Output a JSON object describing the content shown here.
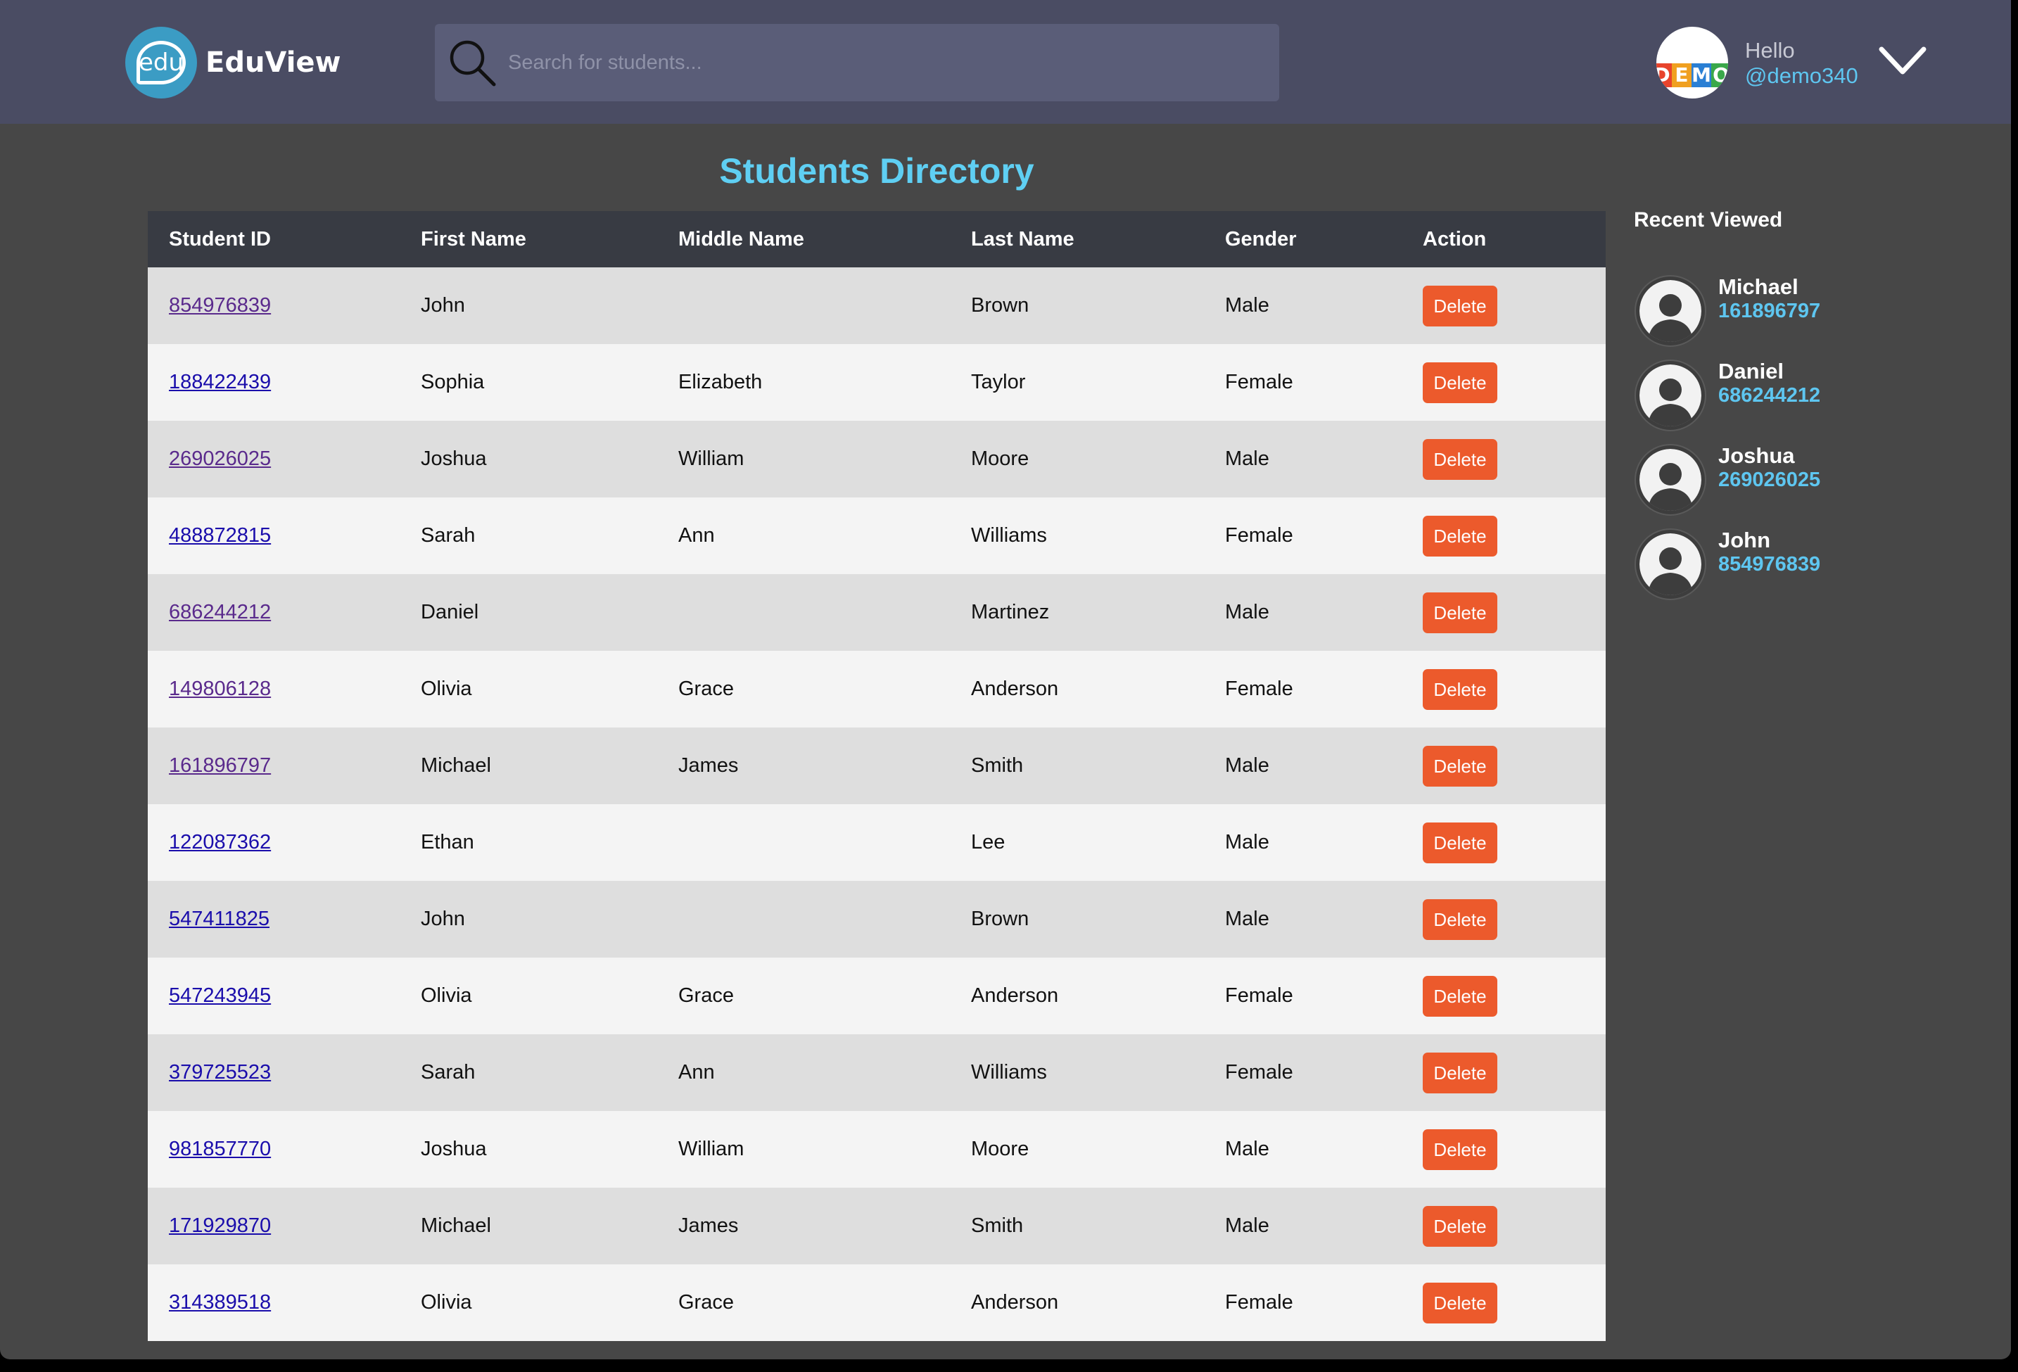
{
  "brand": {
    "name": "EduView",
    "logo_text": "edu",
    "logo_color": "#3b9cc4"
  },
  "search": {
    "placeholder": "Search for students..."
  },
  "user": {
    "greeting": "Hello",
    "handle": "@demo340",
    "avatar_letters": [
      "D",
      "E",
      "M",
      "O"
    ]
  },
  "page": {
    "title": "Students Directory"
  },
  "table": {
    "headers": [
      "Student ID",
      "First Name",
      "Middle Name",
      "Last Name",
      "Gender",
      "Action"
    ],
    "action_label": "Delete",
    "rows": [
      {
        "id": "854976839",
        "first": "John",
        "middle": "",
        "last": "Brown",
        "gender": "Male"
      },
      {
        "id": "188422439",
        "first": "Sophia",
        "middle": "Elizabeth",
        "last": "Taylor",
        "gender": "Female"
      },
      {
        "id": "269026025",
        "first": "Joshua",
        "middle": "William",
        "last": "Moore",
        "gender": "Male"
      },
      {
        "id": "488872815",
        "first": "Sarah",
        "middle": "Ann",
        "last": "Williams",
        "gender": "Female"
      },
      {
        "id": "686244212",
        "first": "Daniel",
        "middle": "",
        "last": "Martinez",
        "gender": "Male"
      },
      {
        "id": "149806128",
        "first": "Olivia",
        "middle": "Grace",
        "last": "Anderson",
        "gender": "Female"
      },
      {
        "id": "161896797",
        "first": "Michael",
        "middle": "James",
        "last": "Smith",
        "gender": "Male"
      },
      {
        "id": "122087362",
        "first": "Ethan",
        "middle": "",
        "last": "Lee",
        "gender": "Male"
      },
      {
        "id": "547411825",
        "first": "John",
        "middle": "",
        "last": "Brown",
        "gender": "Male"
      },
      {
        "id": "547243945",
        "first": "Olivia",
        "middle": "Grace",
        "last": "Anderson",
        "gender": "Female"
      },
      {
        "id": "379725523",
        "first": "Sarah",
        "middle": "Ann",
        "last": "Williams",
        "gender": "Female"
      },
      {
        "id": "981857770",
        "first": "Joshua",
        "middle": "William",
        "last": "Moore",
        "gender": "Male"
      },
      {
        "id": "171929870",
        "first": "Michael",
        "middle": "James",
        "last": "Smith",
        "gender": "Male"
      },
      {
        "id": "314389518",
        "first": "Olivia",
        "middle": "Grace",
        "last": "Anderson",
        "gender": "Female"
      }
    ],
    "visited_ids": [
      "854976839",
      "269026025",
      "686244212",
      "149806128",
      "161896797"
    ]
  },
  "recent": {
    "title": "Recent Viewed",
    "items": [
      {
        "name": "Michael",
        "id": "161896797"
      },
      {
        "name": "Daniel",
        "id": "686244212"
      },
      {
        "name": "Joshua",
        "id": "269026025"
      },
      {
        "name": "John",
        "id": "854976839"
      }
    ]
  },
  "colors": {
    "header_bg": "#4a4c63",
    "page_bg": "#474747",
    "accent": "#5fcff3",
    "delete_button": "#ec5a2c",
    "table_header_bg": "#383b43"
  }
}
